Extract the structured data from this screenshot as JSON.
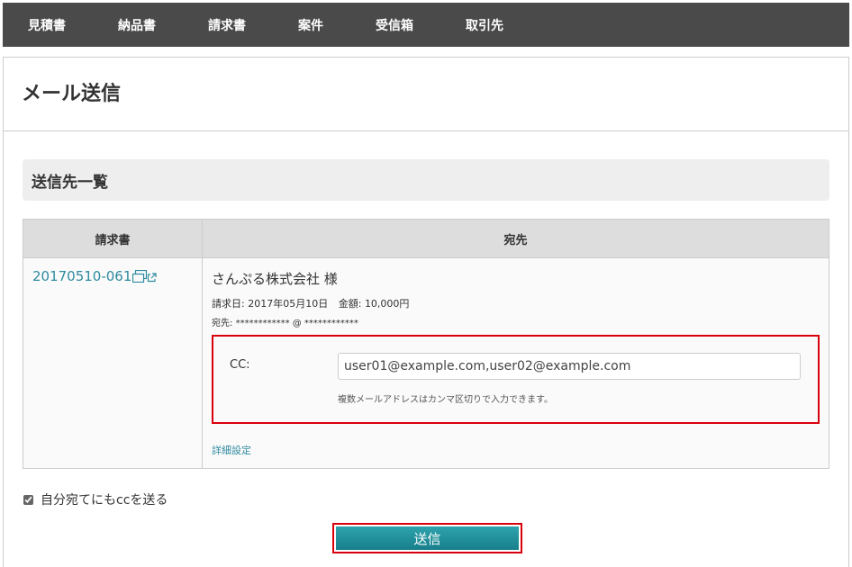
{
  "nav": {
    "items": [
      "見積書",
      "納品書",
      "請求書",
      "案件",
      "受信箱",
      "取引先"
    ]
  },
  "page": {
    "title": "メール送信"
  },
  "section": {
    "title": "送信先一覧"
  },
  "table": {
    "headers": {
      "invoice": "請求書",
      "recipient": "宛先"
    },
    "row": {
      "invoice_number": "20170510-061",
      "company": "さんぷる株式会社 様",
      "invoice_date_label": "請求日:",
      "invoice_date": "2017年05月10日",
      "amount_label": "金額:",
      "amount": "10,000円",
      "to_label": "宛先:",
      "to_address": "************ @ ************",
      "cc_label": "CC:",
      "cc_value": "user01@example.com,user02@example.com",
      "cc_hint": "複数メールアドレスはカンマ区切りで入力できます。",
      "detail_link": "詳細設定"
    }
  },
  "self_cc": {
    "label": "自分宛てにもccを送る",
    "checked": true
  },
  "send_button": {
    "label": "送信"
  },
  "colors": {
    "nav_bg": "#4a4a4a",
    "link": "#2e8ba0",
    "button": "#1f939e",
    "highlight": "#d9000d"
  }
}
